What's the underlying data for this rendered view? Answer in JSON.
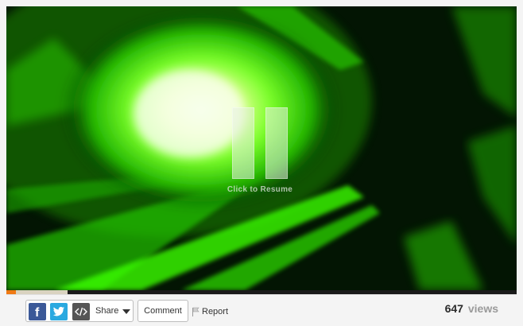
{
  "player": {
    "state": "paused",
    "overlay_icon": "pause-icon",
    "resume_text": "Click to Resume",
    "progress": {
      "played_fraction": 0.018,
      "buffered_fraction": 0.12
    },
    "colors": {
      "accent_played": "#f07a14",
      "buffered": "#d9d3c0",
      "frame_green": "#36ff10"
    }
  },
  "toolbar": {
    "share": {
      "facebook_icon": "facebook-icon",
      "twitter_icon": "twitter-icon",
      "embed_icon": "embed-code-icon",
      "label": "Share",
      "dropdown_icon": "chevron-down-icon"
    },
    "comment_label": "Comment",
    "report": {
      "icon": "flag-icon",
      "label": "Report"
    },
    "views": {
      "count": "647",
      "label": "views"
    }
  }
}
